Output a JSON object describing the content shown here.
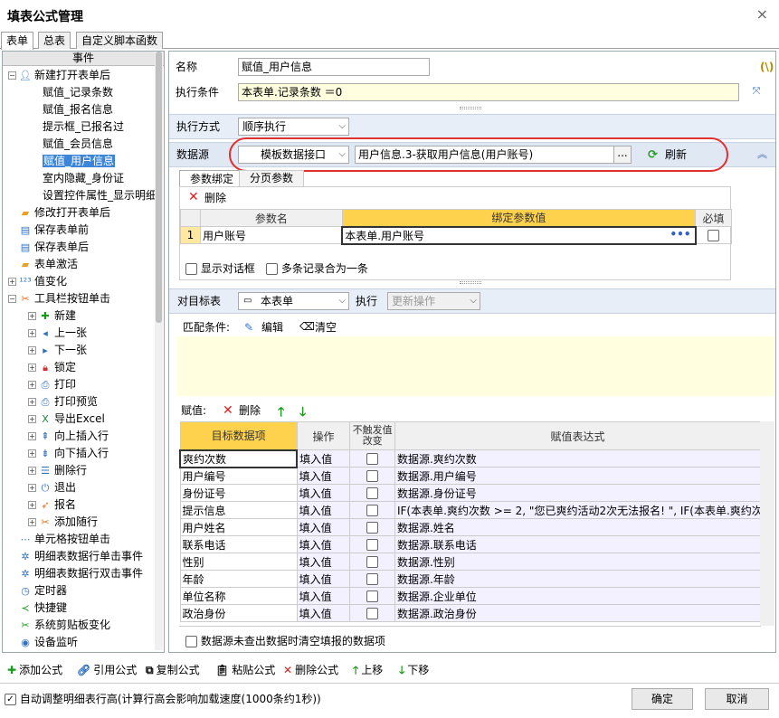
{
  "window": {
    "title": "填表公式管理",
    "close_label": "×"
  },
  "tabs": [
    "表单",
    "总表",
    "自定义脚本函数"
  ],
  "tree": {
    "header": "事件",
    "items": [
      {
        "label": "新建打开表单后",
        "level": 0,
        "expander": "minus",
        "icon": "user-gear-icon"
      },
      {
        "label": "赋值_记录条数",
        "level": 1
      },
      {
        "label": "赋值_报名信息",
        "level": 1
      },
      {
        "label": "提示框_已报名过",
        "level": 1
      },
      {
        "label": "赋值_会员信息",
        "level": 1
      },
      {
        "label": "赋值_用户信息",
        "level": 1,
        "selected": true
      },
      {
        "label": "室内隐藏_身份证",
        "level": 1
      },
      {
        "label": "设置控件属性_显示明细",
        "level": 1
      },
      {
        "label": "修改打开表单后",
        "level": 0,
        "icon": "folder-open-icon"
      },
      {
        "label": "保存表单前",
        "level": 0,
        "icon": "save-form-icon"
      },
      {
        "label": "保存表单后",
        "level": 0,
        "icon": "save-form-icon"
      },
      {
        "label": "表单激活",
        "level": 0,
        "icon": "folder-open-icon"
      },
      {
        "label": "值变化",
        "level": 0,
        "expander": "plus",
        "icon": "value-123-icon"
      },
      {
        "label": "工具栏按钮单击",
        "level": 0,
        "expander": "minus",
        "icon": "tools-icon"
      },
      {
        "label": "新建",
        "level": 1,
        "expander": "plus",
        "icon": "new-icon"
      },
      {
        "label": "上一张",
        "level": 1,
        "expander": "plus",
        "icon": "prev-icon"
      },
      {
        "label": "下一张",
        "level": 1,
        "expander": "plus",
        "icon": "next-icon"
      },
      {
        "label": "锁定",
        "level": 1,
        "expander": "plus",
        "icon": "lock-icon"
      },
      {
        "label": "打印",
        "level": 1,
        "expander": "plus",
        "icon": "print-icon"
      },
      {
        "label": "打印预览",
        "level": 1,
        "expander": "plus",
        "icon": "print-preview-icon"
      },
      {
        "label": "导出Excel",
        "level": 1,
        "expander": "plus",
        "icon": "excel-icon"
      },
      {
        "label": "向上插入行",
        "level": 1,
        "expander": "plus",
        "icon": "insert-up-icon"
      },
      {
        "label": "向下插入行",
        "level": 1,
        "expander": "plus",
        "icon": "insert-down-icon"
      },
      {
        "label": "删除行",
        "level": 1,
        "expander": "plus",
        "icon": "delete-row-icon"
      },
      {
        "label": "退出",
        "level": 1,
        "expander": "plus",
        "icon": "power-icon"
      },
      {
        "label": "报名",
        "level": 1,
        "expander": "plus",
        "icon": "rocket-icon"
      },
      {
        "label": "添加随行",
        "level": 1,
        "expander": "plus",
        "icon": "tools-icon"
      },
      {
        "label": "单元格按钮单击",
        "level": 0,
        "icon": "dots-icon"
      },
      {
        "label": "明细表数据行单击事件",
        "level": 0,
        "icon": "gear-ring-icon"
      },
      {
        "label": "明细表数据行双击事件",
        "level": 0,
        "icon": "gear-ring-icon"
      },
      {
        "label": "定时器",
        "level": 0,
        "icon": "timer-icon"
      },
      {
        "label": "快捷键",
        "level": 0,
        "icon": "share-icon"
      },
      {
        "label": "系统剪贴板变化",
        "level": 0,
        "icon": "scissors-icon"
      },
      {
        "label": "设备监听",
        "level": 0,
        "icon": "device-icon"
      }
    ]
  },
  "form": {
    "name_label": "名称",
    "name_value": "赋值_用户信息",
    "cond_label": "执行条件",
    "cond_value": "本表单.记录条数 ＝0",
    "func_glyph": "(\\)",
    "exec_label": "执行方式",
    "exec_value": "顺序执行",
    "ds_label": "数据源",
    "ds_type": "模板数据接口",
    "ds_value": "用户信息.3-获取用户信息(用户账号)",
    "ds_browse": "...",
    "refresh_label": "刷新"
  },
  "params": {
    "tabs": [
      "参数绑定",
      "分页参数"
    ],
    "delete_label": "删除",
    "headers": [
      "参数名",
      "绑定参数值",
      "必填"
    ],
    "rows": [
      {
        "no": "1",
        "name": "用户账号",
        "value": "本表单.用户账号"
      }
    ],
    "opt1": "显示对话框",
    "opt2": "多条记录合为一条"
  },
  "target": {
    "label": "对目标表",
    "value": "本表单",
    "exec_label": "执行",
    "exec_value": "更新操作",
    "match_label": "匹配条件:",
    "edit_label": "编辑",
    "clear_label": "清空",
    "assign_label": "赋值:",
    "delete_label": "删除",
    "headers": [
      "目标数据项",
      "操作",
      "不触发值改变",
      "赋值表达式"
    ],
    "rows": [
      {
        "item": "爽约次数",
        "op": "填入值",
        "expr": "数据源.爽约次数"
      },
      {
        "item": "用户编号",
        "op": "填入值",
        "expr": "数据源.用户编号"
      },
      {
        "item": "身份证号",
        "op": "填入值",
        "expr": "数据源.身份证号"
      },
      {
        "item": "提示信息",
        "op": "填入值",
        "expr": "IF(本表单.爽约次数 >= 2, \"您已爽约活动2次无法报名! \", IF(本表单.爽约次"
      },
      {
        "item": "用户姓名",
        "op": "填入值",
        "expr": "数据源.姓名"
      },
      {
        "item": "联系电话",
        "op": "填入值",
        "expr": "数据源.联系电话"
      },
      {
        "item": "性别",
        "op": "填入值",
        "expr": "数据源.性别"
      },
      {
        "item": "年龄",
        "op": "填入值",
        "expr": "数据源.年龄"
      },
      {
        "item": "单位名称",
        "op": "填入值",
        "expr": "数据源.企业单位"
      },
      {
        "item": "政治身份",
        "op": "填入值",
        "expr": "数据源.政治身份"
      }
    ],
    "clear_opt": "数据源未查出数据时清空填报的数据项"
  },
  "toolbar": {
    "add": "添加公式",
    "ref": "引用公式",
    "copy": "复制公式",
    "paste": "粘贴公式",
    "delete": "删除公式",
    "up": "上移",
    "down": "下移"
  },
  "footer": {
    "auto_label": "自动调整明细表行高(计算行高会影响加载速度(1000条约1秒))",
    "ok": "确定",
    "cancel": "取消"
  }
}
